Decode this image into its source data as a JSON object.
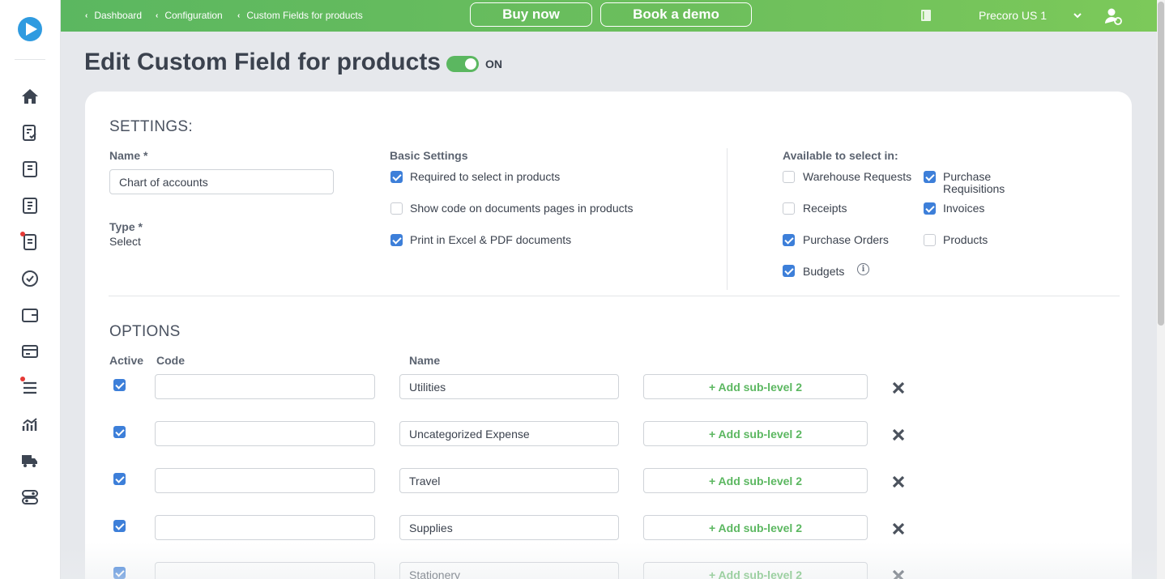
{
  "topbar": {
    "breadcrumbs": [
      "Dashboard",
      "Configuration",
      "Custom Fields for products"
    ],
    "buy_now": "Buy now",
    "book_demo": "Book a demo",
    "company": "Precoro US 1"
  },
  "sidebar": {
    "icons": [
      "home-icon",
      "requisition-icon",
      "document-icon",
      "document-icon",
      "receipt-icon",
      "approval-icon",
      "wallet-icon",
      "card-icon",
      "list-icon",
      "analytics-icon",
      "truck-icon",
      "settings-icon"
    ]
  },
  "page": {
    "title": "Edit Custom Field for products",
    "status": "ON"
  },
  "settings": {
    "heading": "SETTINGS:",
    "name_label": "Name *",
    "name_value": "Chart of accounts",
    "type_label": "Type *",
    "type_value": "Select",
    "basic_heading": "Basic Settings",
    "basic": [
      {
        "label": "Required to select in products",
        "checked": true
      },
      {
        "label": "Show code on documents pages in products",
        "checked": false
      },
      {
        "label": "Print in Excel & PDF documents",
        "checked": true
      }
    ],
    "available_heading": "Available to select in:",
    "available": [
      {
        "label": "Warehouse Requests",
        "checked": false
      },
      {
        "label": "Purchase Requisitions",
        "checked": true
      },
      {
        "label": "Receipts",
        "checked": false
      },
      {
        "label": "Invoices",
        "checked": true
      },
      {
        "label": "Purchase Orders",
        "checked": true
      },
      {
        "label": "Products",
        "checked": false
      },
      {
        "label": "Budgets",
        "checked": true
      }
    ],
    "purchase_line1": "Purchase",
    "purchase_line2": "Requisitions",
    "info_glyph": "i"
  },
  "options": {
    "heading": "OPTIONS",
    "col_active": "Active",
    "col_code": "Code",
    "col_name": "Name",
    "add_sub_label": "+ Add sub-level 2",
    "rows": [
      {
        "active": true,
        "code": "",
        "name": "Utilities"
      },
      {
        "active": true,
        "code": "",
        "name": "Uncategorized Expense"
      },
      {
        "active": true,
        "code": "",
        "name": "Travel"
      },
      {
        "active": true,
        "code": "",
        "name": "Supplies"
      },
      {
        "active": true,
        "code": "",
        "name": "Stationery"
      }
    ]
  },
  "colors": {
    "accent_green": "#5bb760",
    "checkbox_blue": "#3d7fd9",
    "logo_blue": "#2f9be0"
  }
}
